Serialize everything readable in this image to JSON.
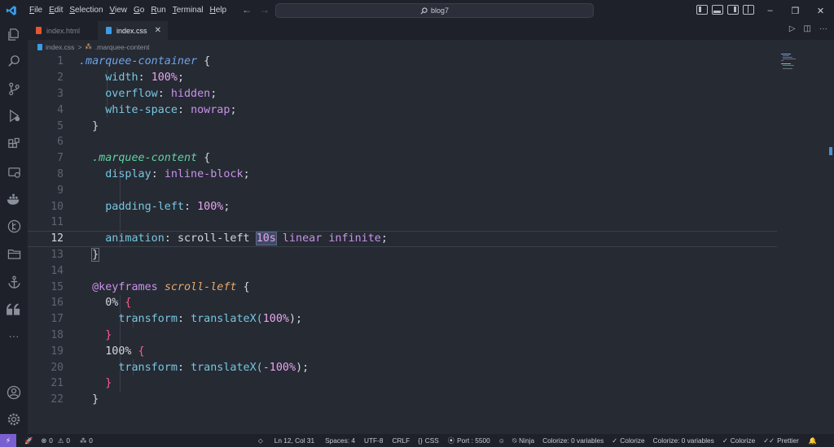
{
  "menu": [
    "File",
    "Edit",
    "Selection",
    "View",
    "Go",
    "Run",
    "Terminal",
    "Help"
  ],
  "search": {
    "text": "blog7"
  },
  "window_controls": {
    "minimize": "–",
    "restore": "❐",
    "close": "✕"
  },
  "tabs": [
    {
      "label": "index.html",
      "active": false
    },
    {
      "label": "index.css",
      "active": true,
      "close": "✕"
    }
  ],
  "breadcrumb": {
    "file": "index.css",
    "symbol": ".marquee-content",
    "separator": ">"
  },
  "editor": {
    "current_line": 12,
    "line_numbers": [
      "1",
      "2",
      "3",
      "4",
      "5",
      "6",
      "7",
      "8",
      "9",
      "10",
      "11",
      "12",
      "13",
      "14",
      "15",
      "16",
      "17",
      "18",
      "19",
      "20",
      "21",
      "22"
    ]
  },
  "code": {
    "l1_sel": ".marquee-container",
    "l1_brace": " {",
    "l2_prop": "width",
    "l2_colon": ": ",
    "l2_val": "100%",
    "l2_end": ";",
    "l3_prop": "overflow",
    "l3_colon": ": ",
    "l3_val": "hidden",
    "l3_end": ";",
    "l4_prop": "white-space",
    "l4_colon": ": ",
    "l4_val": "nowrap",
    "l4_end": ";",
    "l5": "}",
    "l7_sel": ".marquee-content",
    "l7_brace": " {",
    "l8_prop": "display",
    "l8_colon": ": ",
    "l8_val": "inline-block",
    "l8_end": ";",
    "l10_prop": "padding-left",
    "l10_colon": ": ",
    "l10_val": "100%",
    "l10_end": ";",
    "l12_prop": "animation",
    "l12_colon": ": ",
    "l12_a": "scroll-left ",
    "l12_b": "10s",
    "l12_c": " linear infinite",
    "l12_end": ";",
    "l13": "}",
    "l15_at": "@keyframes ",
    "l15_name": "scroll-left",
    "l15_brace": " {",
    "l16_pct": "0%",
    "l16_brace": " {",
    "l17_prop": "transform",
    "l17_colon": ": ",
    "l17_fn": "translateX(",
    "l17_val": "100%",
    "l17_end": ");",
    "l18": "}",
    "l19_pct": "100%",
    "l19_brace": " {",
    "l20_prop": "transform",
    "l20_colon": ": ",
    "l20_fn": "translateX(",
    "l20_val": "-100%",
    "l20_end": ");",
    "l21": "}",
    "l22": "}"
  },
  "status": {
    "errors": "0",
    "warnings": "0",
    "ports": "0",
    "position": "Ln 12, Col 31",
    "spaces": "Spaces: 4",
    "encoding": "UTF-8",
    "eol": "CRLF",
    "language": "CSS",
    "port": "Port : 5500",
    "ninja": "Ninja",
    "colorize_vars_1": "Colorize: 0 variables",
    "colorize_1": "Colorize",
    "colorize_vars_2": "Colorize: 0 variables",
    "colorize_2": "Colorize",
    "prettier": "Prettier"
  },
  "colors": {
    "accent": "#7a5fd0",
    "selector": "#6ea4e8",
    "property": "#76c7e0",
    "value": "#c792ea",
    "brace": "#ff5a8a"
  }
}
